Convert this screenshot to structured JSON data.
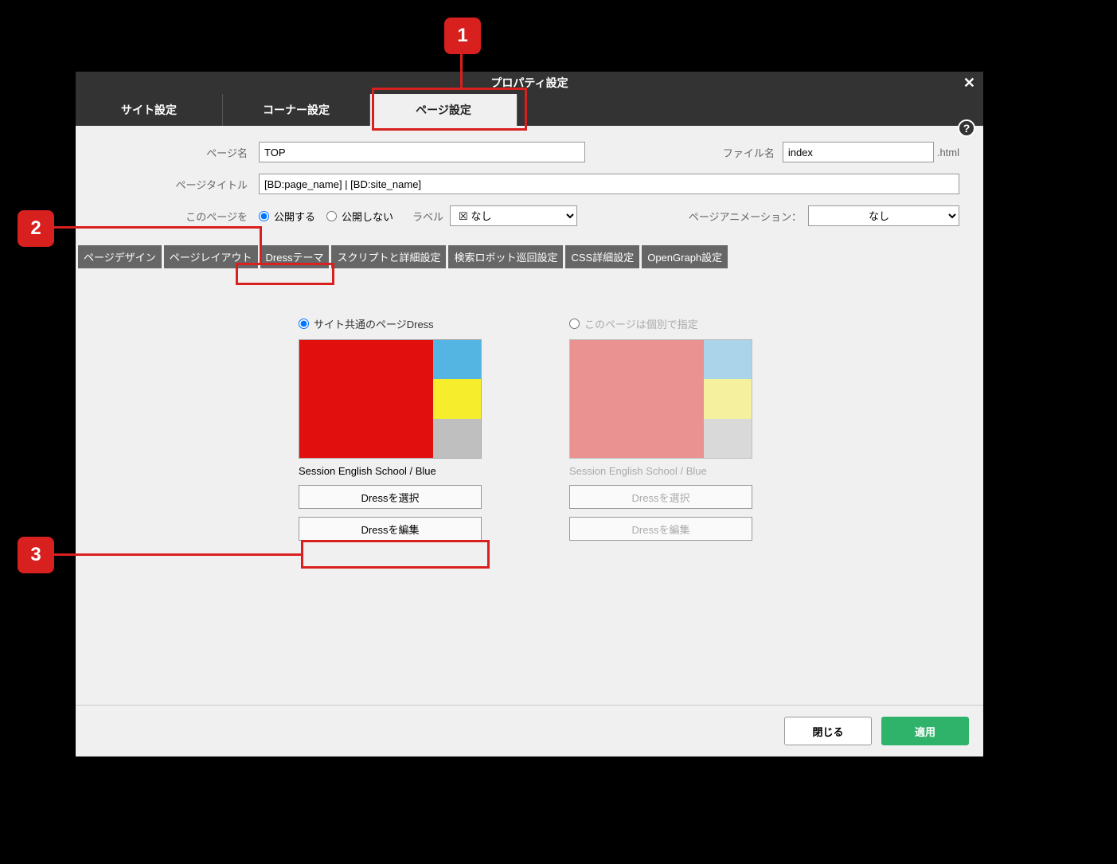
{
  "dialog": {
    "title": "プロパティ設定",
    "help_tooltip": "?",
    "close_label": "✕"
  },
  "toptabs": [
    {
      "label": "サイト設定"
    },
    {
      "label": "コーナー設定"
    },
    {
      "label": "ページ設定"
    }
  ],
  "form": {
    "page_name_label": "ページ名",
    "page_name_value": "TOP",
    "file_name_label": "ファイル名",
    "file_name_value": "index",
    "file_name_ext": ".html",
    "page_title_label": "ページタイトル",
    "page_title_value": "[BD:page_name] | [BD:site_name]",
    "publish_label": "このページを",
    "publish_option_yes": "公開する",
    "publish_option_no": "公開しない",
    "label_label": "ラベル",
    "label_value": "☒ なし",
    "page_animation_label": "ページアニメーション：",
    "page_animation_value": "なし"
  },
  "subtabs": [
    "ページデザイン",
    "ページレイアウト",
    "Dressテーマ",
    "スクリプトと詳細設定",
    "検索ロボット巡回設定",
    "CSS詳細設定",
    "OpenGraph設定"
  ],
  "dress": {
    "shared_radio_label": "サイト共通のページDress",
    "individual_radio_label": "このページは個別で指定",
    "caption": "Session English School / Blue",
    "select_btn": "Dressを選択",
    "edit_btn": "Dressを編集",
    "colors_active": {
      "main": "#e20f0f",
      "r1": "#54b4e2",
      "r2": "#f6ee2d",
      "r3": "#bfbfbf"
    },
    "colors_muted": {
      "main": "#e86a6a",
      "r1": "#8fc9e8",
      "r2": "#f6f07a",
      "r3": "#d0d0d0"
    }
  },
  "footer": {
    "close": "閉じる",
    "apply": "適用"
  },
  "callouts": {
    "c1": "1",
    "c2": "2",
    "c3": "3"
  }
}
